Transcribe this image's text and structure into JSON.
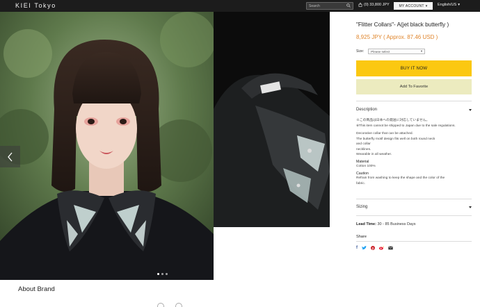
{
  "header": {
    "logo": "KIEI Tokyo",
    "search_placeholder": "Search",
    "cart_text": "(0) 33,800 JPY",
    "account_label": "MY ACCOUNT",
    "language_label": "English/US"
  },
  "gallery": {
    "dots_total": 3,
    "active_dot": 1
  },
  "product": {
    "title": "\"Flitter Collars\"- A(jet black butterfly )",
    "price": "8,925 JPY ( Approx. 87.46 USD )",
    "size_label": "Size:",
    "size_value": "Please select",
    "buy_label": "BUY IT NOW",
    "favorite_label": "Add To Favorite",
    "description_label": "Description",
    "description_lines_1": [
      "※この商品は日本への発送に対応していません。",
      "※This item cannot be shipped to Japan due to the sale regulations."
    ],
    "description_lines_2": [
      "Decorative collar that can be attached.",
      "The butterfly motif design fits well on both round neck",
      "and collar",
      "necklines.",
      "Wearable in all weather."
    ],
    "material_label": "Material",
    "material_value": "Cotton 100%",
    "caution_label": "Caution",
    "caution_lines": [
      "Refrain from washing to keep the shape and the color of the",
      "fabric."
    ],
    "sizing_label": "Sizing",
    "lead_time_label": "Lead Time:",
    "lead_time_value": "30 - 85 Business Days",
    "share_label": "Share"
  },
  "about": {
    "title": "About Brand"
  },
  "colors": {
    "topbar": "#1c1c1c",
    "price": "#e0862d",
    "buy": "#fbc811",
    "favorite": "#ecebbf"
  }
}
